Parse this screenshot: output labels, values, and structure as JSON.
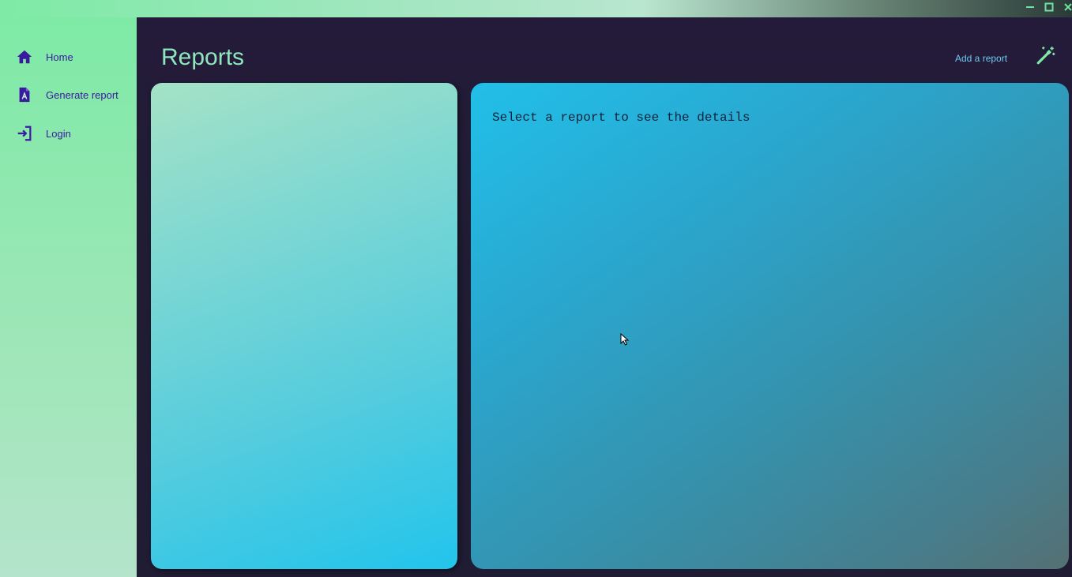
{
  "titlebar": {
    "buttons": [
      {
        "name": "minimize",
        "icon": "minimize-icon"
      },
      {
        "name": "maximize",
        "icon": "maximize-icon"
      },
      {
        "name": "close",
        "icon": "close-icon"
      }
    ]
  },
  "sidebar": {
    "items": [
      {
        "label": "Home",
        "icon": "home-icon"
      },
      {
        "label": "Generate report",
        "icon": "document-icon"
      },
      {
        "label": "Login",
        "icon": "login-icon"
      }
    ]
  },
  "main": {
    "title": "Reports",
    "add_report_label": "Add a report",
    "add_icon": "magic-wand-icon",
    "detail_placeholder": "Select a report to see the details"
  },
  "colors": {
    "accent_purple": "#3a1a9e",
    "title_green": "#8fe6bd",
    "link_blue": "#6ec9ef",
    "background": "#1f1c33"
  }
}
